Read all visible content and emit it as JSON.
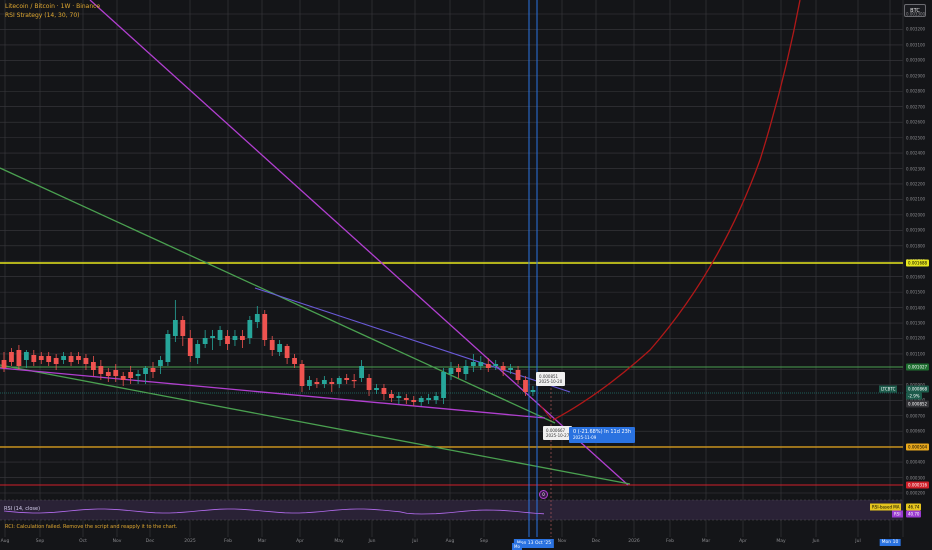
{
  "header": {
    "title": "Litecoin / Bitcoin · 1W · Binance",
    "indicator": "RSI Strategy (14, 30, 70)",
    "symbol_button": "BTC"
  },
  "price_axis": {
    "ticks": [
      "0.003300",
      "0.003200",
      "0.003100",
      "0.003000",
      "0.002900",
      "0.002800",
      "0.002700",
      "0.002600",
      "0.002500",
      "0.002400",
      "0.002300",
      "0.002200",
      "0.002100",
      "0.002000",
      "0.001900",
      "0.001800",
      "0.001700",
      "0.001600",
      "0.001500",
      "0.001400",
      "0.001300",
      "0.001200",
      "0.001100",
      "0.001000",
      "0.000900",
      "0.000800",
      "0.000700",
      "0.000600",
      "0.000500",
      "0.000400",
      "0.000300",
      "0.000200"
    ],
    "badges": {
      "yellow_level": "0.001688",
      "green_level": "0.001027",
      "current_price": "0.000868",
      "current_label": "LTCBTC",
      "current_change": "-2.9%",
      "secondary_price": "0.000852",
      "orange_level": "0.000504",
      "red_level": "0.000316",
      "rsi_ma_value": "46.74",
      "rsi_ma_label": "RSI-based MA",
      "rsi_value": "40.70",
      "rsi_label": "RSI"
    }
  },
  "time_axis": {
    "labels": [
      "Aug",
      "Sep",
      "Oct",
      "Nov",
      "Dec",
      "2025",
      "Feb",
      "Mar",
      "Apr",
      "May",
      "Jun",
      "Jul",
      "Aug",
      "Sep",
      "Nov",
      "Dec",
      "2026",
      "Feb",
      "Mar",
      "Apr",
      "May",
      "Jun",
      "Jul",
      "Mon 10"
    ],
    "cursor_label": "Mon 13 Oct '25",
    "cursor_side_label": "Mo"
  },
  "annotations": {
    "note1_price": "0.000851",
    "note1_date": "2025-10-20",
    "note2_price": "0.000667",
    "note2_date": "2025-10-27",
    "projection_text": "0 (-21.68%) In 11d 23h",
    "projection_date": "2025-11-09",
    "marker": "0",
    "current_tag": "LTC/BTC"
  },
  "rsi": {
    "label": "RSI (14, close)"
  },
  "status": {
    "error": "RCI: Calculation failed. Remove the script and reapply it to the chart."
  },
  "colors": {
    "background": "#141518",
    "grid": "#3a3a3e",
    "up": "#26a69a",
    "down": "#ef5350",
    "trend_purple": "#b13fd0",
    "trend_green": "#4aa050",
    "yellow": "#e6e61e",
    "orange": "#e8a81c",
    "red_line": "#d0202a",
    "cursor_blue": "#2a72e0",
    "parabola": "#b01818"
  }
}
